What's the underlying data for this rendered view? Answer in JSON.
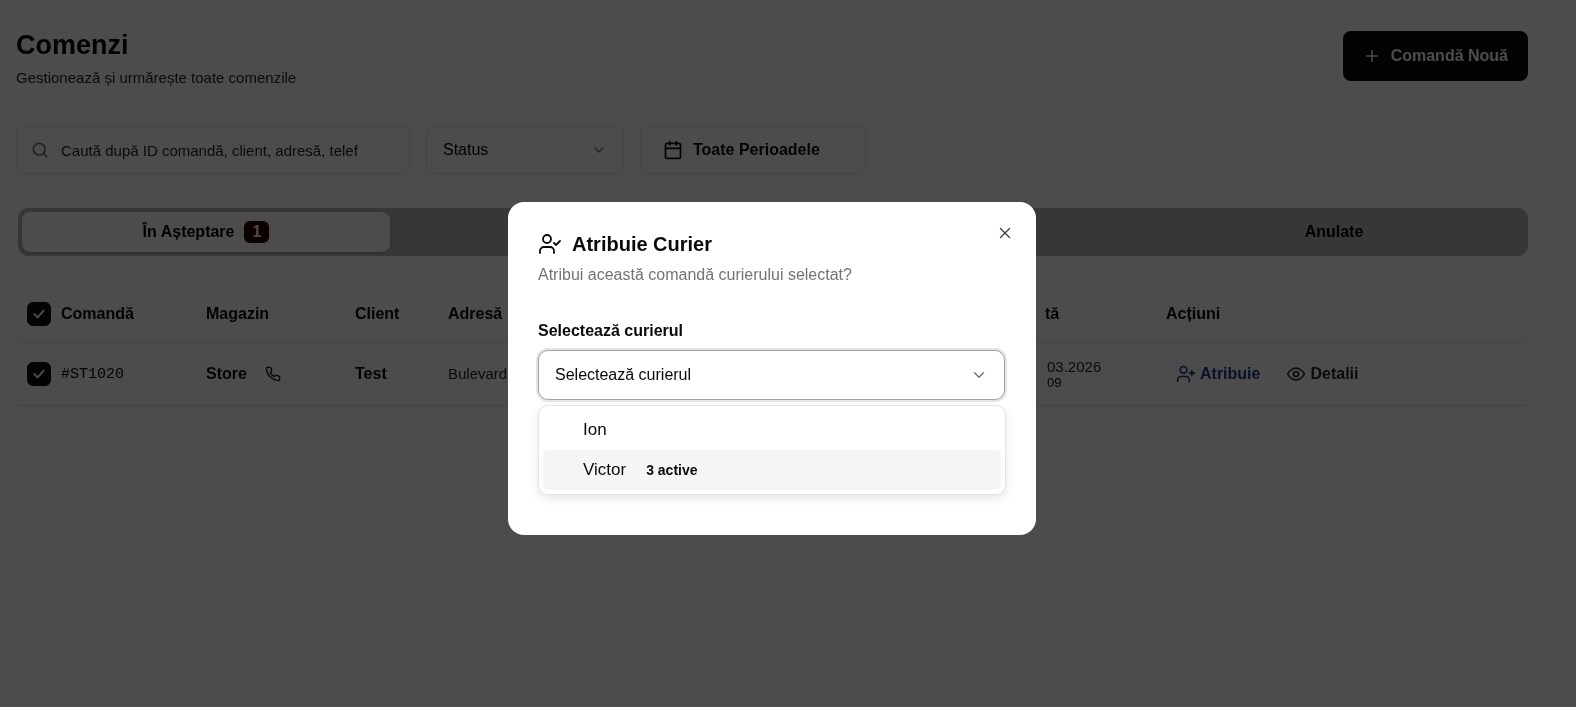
{
  "page": {
    "title": "Comenzi",
    "subtitle": "Gestionează și urmărește toate comenzile",
    "new_button": "Comandă Nouă"
  },
  "filters": {
    "search": {
      "placeholder": "Caută după ID comandă, client, adresă, telef"
    },
    "status": {
      "value": "Status"
    },
    "period": {
      "label": "Toate Perioadele"
    }
  },
  "tabs": [
    {
      "label": "În Așteptare",
      "badge": "1",
      "selected": true
    },
    {
      "label": "Anulate",
      "selected": false
    }
  ],
  "table": {
    "select_all": {
      "checked": true
    },
    "columns": [
      {
        "label": "Comandă"
      },
      {
        "label": "Magazin"
      },
      {
        "label": "Client"
      },
      {
        "label": "Adresă"
      },
      {
        "label": "tă"
      },
      {
        "label": "Acțiuni"
      }
    ],
    "rows": [
      {
        "checked": true,
        "id": "#ST1020",
        "store": "Store",
        "client": "Test",
        "address": "Bulevard",
        "date": "03.2026",
        "time": "09",
        "actions": [
          {
            "kind": "assign",
            "label": "Atribuie"
          },
          {
            "kind": "details",
            "label": "Detalii"
          }
        ]
      }
    ]
  },
  "dialog": {
    "title": "Atribuie Curier",
    "description": "Atribui această comandă curierului selectat?",
    "field_label": "Selectează curierul",
    "select": {
      "placeholder": "Selectează curierul",
      "expanded": true
    },
    "options": [
      {
        "label": "Ion",
        "selected": false
      },
      {
        "label": "Victor",
        "badge": "3 active",
        "selected": true
      }
    ]
  }
}
